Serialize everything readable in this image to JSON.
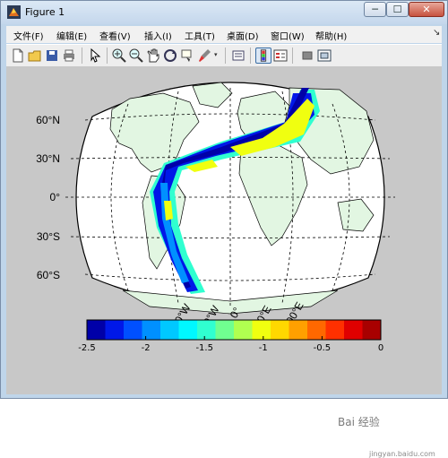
{
  "window": {
    "title": "Figure 1"
  },
  "menu": [
    "文件(F)",
    "编辑(E)",
    "查看(V)",
    "插入(I)",
    "工具(T)",
    "桌面(D)",
    "窗口(W)",
    "帮助(H)"
  ],
  "map": {
    "lat_labels": [
      "60°N",
      "30°N",
      "0°",
      "30°S",
      "60°S"
    ],
    "lon_labels": [
      "60°W",
      "30°W",
      "0°",
      "30°E",
      "100°E"
    ]
  },
  "colorbar": {
    "ticks": [
      "-2.5",
      "-2",
      "-1.5",
      "-1",
      "-0.5",
      "0"
    ],
    "colors": [
      "#0000a8",
      "#0018e8",
      "#0050ff",
      "#0090ff",
      "#00c8ff",
      "#00f8ff",
      "#30ffd0",
      "#70ff90",
      "#b0ff50",
      "#f0ff10",
      "#ffd800",
      "#ffa000",
      "#ff6800",
      "#ff3000",
      "#e00000",
      "#a80000"
    ]
  },
  "watermark": {
    "text": "Bai 经验",
    "url": "jingyan.baidu.com"
  }
}
